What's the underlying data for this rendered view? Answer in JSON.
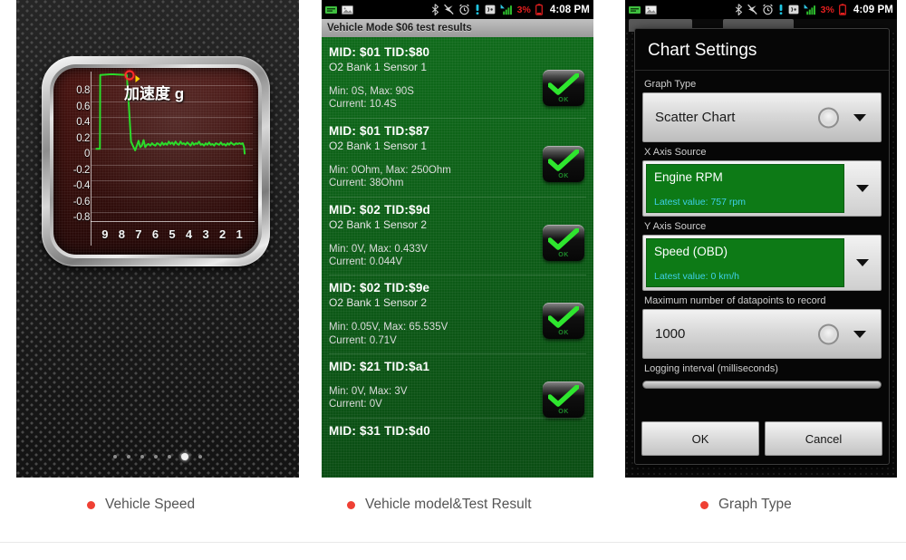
{
  "panel1": {
    "name": "Vehicle Speed gauge screen",
    "dots": {
      "count": 7,
      "active_index": 5
    },
    "chart_data": {
      "type": "line",
      "title": "加速度 g",
      "xlabel": "",
      "ylabel": "",
      "ylim": [
        -0.9,
        0.95
      ],
      "yticks": [
        "0.8",
        "0.6",
        "0.4",
        "0.2",
        "0",
        "-0.2",
        "-0.4",
        "-0.6",
        "-0.8"
      ],
      "xticks": [
        "9",
        "8",
        "7",
        "6",
        "5",
        "4",
        "3",
        "2",
        "1"
      ],
      "grid": true,
      "line_color": "#2bdc2b",
      "marker": {
        "x": 7.55,
        "y": 0.93,
        "color": "#ff2a2a"
      },
      "series": [
        {
          "name": "加速度 g",
          "x": [
            9.55,
            9.3,
            9.28,
            8.6,
            7.7,
            7.58,
            7.45,
            7.3,
            7.2,
            7.1,
            7.0,
            6.9,
            6.8,
            6.7,
            6.6,
            6.5,
            6.4,
            6.3,
            6.2,
            6.1,
            6.0,
            5.9,
            5.8,
            5.7,
            5.6,
            5.5,
            5.4,
            5.3,
            5.2,
            5.1,
            5.0,
            4.9,
            4.8,
            4.7,
            4.6,
            4.5,
            4.4,
            4.3,
            4.2,
            4.1,
            4.0,
            3.9,
            3.8,
            3.7,
            3.6,
            3.5,
            3.4,
            3.3,
            3.2,
            3.1,
            3.0,
            2.9,
            2.8,
            2.7,
            2.6,
            2.5,
            2.4,
            2.3,
            2.2,
            2.1,
            2.0,
            1.9,
            1.8,
            1.7,
            1.6,
            1.5,
            1.4,
            1.3,
            1.2,
            1.1,
            1.0,
            0.9,
            0.8,
            0.72,
            0.68
          ],
          "y": [
            0.0,
            0.0,
            0.93,
            0.94,
            0.93,
            0.55,
            0.09,
            0.02,
            -0.02,
            0.04,
            0.1,
            0.02,
            0.04,
            0.11,
            0.02,
            0.05,
            0.06,
            0.04,
            0.07,
            0.05,
            0.04,
            0.07,
            0.06,
            0.04,
            0.08,
            0.05,
            0.07,
            0.05,
            0.09,
            0.06,
            0.08,
            0.05,
            0.09,
            0.06,
            0.05,
            0.09,
            0.06,
            0.07,
            0.05,
            0.08,
            0.06,
            0.04,
            0.08,
            0.05,
            0.07,
            0.06,
            0.09,
            0.05,
            0.06,
            0.04,
            0.07,
            0.05,
            0.08,
            0.05,
            0.06,
            0.04,
            0.07,
            0.06,
            0.05,
            0.08,
            0.05,
            0.06,
            0.04,
            0.07,
            0.05,
            0.08,
            0.06,
            0.05,
            0.07,
            0.06,
            0.07,
            0.06,
            0.07,
            0.02,
            -0.07
          ]
        }
      ]
    }
  },
  "panel2": {
    "statusbar": {
      "time": "4:08 PM",
      "battery_pct": "3%",
      "left_icons": [
        "usb-debug-icon",
        "screenshot-image-icon"
      ],
      "right_icons": [
        "bluetooth-icon",
        "gps-off-icon",
        "alarm-clock-icon",
        "vibrate-icon",
        "nfc-icon",
        "signal-bars-icon",
        "battery-icon"
      ]
    },
    "title": "Vehicle Mode $06 test results",
    "items": [
      {
        "mid": "MID: $01 TID:$80",
        "sensor": "O2 Bank 1 Sensor 1",
        "minmax": "Min: 0S, Max: 90S",
        "current": "Current: 10.4S",
        "status": "OK"
      },
      {
        "mid": "MID: $01 TID:$87",
        "sensor": "O2 Bank 1 Sensor 1",
        "minmax": "Min: 0Ohm, Max: 250Ohm",
        "current": "Current: 38Ohm",
        "status": "OK"
      },
      {
        "mid": "MID: $02 TID:$9d",
        "sensor": "O2 Bank 1 Sensor 2",
        "minmax": "Min: 0V, Max: 0.433V",
        "current": "Current: 0.044V",
        "status": "OK"
      },
      {
        "mid": "MID: $02 TID:$9e",
        "sensor": "O2 Bank 1 Sensor 2",
        "minmax": "Min: 0.05V, Max: 65.535V",
        "current": "Current: 0.71V",
        "status": "OK"
      },
      {
        "mid": "MID: $21 TID:$a1",
        "sensor": "",
        "minmax": "Min: 0V, Max: 3V",
        "current": "Current: 0V",
        "status": "OK"
      },
      {
        "mid": "MID: $31 TID:$d0",
        "sensor": "",
        "minmax": "",
        "current": "",
        "status": ""
      }
    ]
  },
  "panel3": {
    "statusbar": {
      "time": "4:09 PM",
      "battery_pct": "3%",
      "left_icons": [
        "usb-debug-icon",
        "screenshot-image-icon"
      ],
      "right_icons": [
        "bluetooth-icon",
        "gps-off-icon",
        "alarm-clock-icon",
        "vibrate-icon",
        "nfc-icon",
        "signal-bars-icon",
        "battery-icon"
      ]
    },
    "dialog": {
      "title": "Chart Settings",
      "graph_type": {
        "label": "Graph Type",
        "value": "Scatter Chart"
      },
      "x_axis": {
        "label": "X Axis Source",
        "value": "Engine RPM",
        "latest": "Latest value: 757 rpm"
      },
      "y_axis": {
        "label": "Y Axis Source",
        "value": "Speed (OBD)",
        "latest": "Latest value: 0 km/h"
      },
      "max_datapoints": {
        "label": "Maximum number of datapoints to record",
        "value": "1000"
      },
      "logging_interval": {
        "label": "Logging interval (milliseconds)"
      },
      "ok_label": "OK",
      "cancel_label": "Cancel"
    }
  },
  "captions": {
    "c1": "Vehicle Speed",
    "c2": "Vehicle model&Test Result",
    "c3": "Graph Type"
  },
  "colors": {
    "caption_dot": "#ef4034",
    "panel2_green": "#0c5a16",
    "field_green": "#0d7a16",
    "latest_cyan": "#3fd0e8",
    "battery_red": "#e41f1f",
    "line_green": "#2bdc2b"
  }
}
